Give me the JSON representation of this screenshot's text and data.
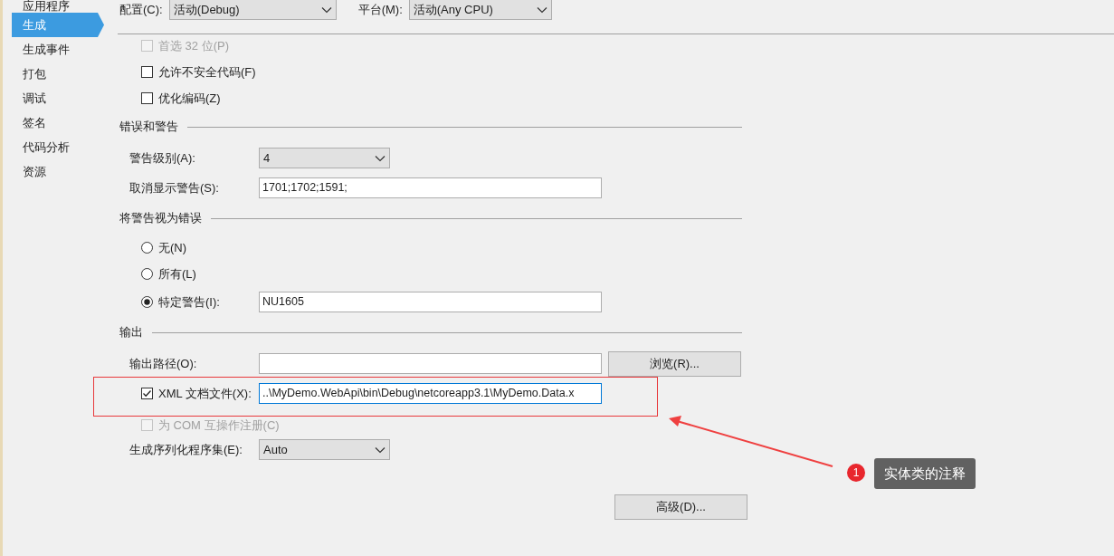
{
  "sidebar": {
    "items": [
      {
        "label": "应用程序",
        "selected": false
      },
      {
        "label": "生成",
        "selected": true
      },
      {
        "label": "生成事件",
        "selected": false
      },
      {
        "label": "打包",
        "selected": false
      },
      {
        "label": "调试",
        "selected": false
      },
      {
        "label": "签名",
        "selected": false
      },
      {
        "label": "代码分析",
        "selected": false
      },
      {
        "label": "资源",
        "selected": false
      }
    ]
  },
  "configuration": {
    "label": "配置(C):",
    "value": "活动(Debug)"
  },
  "platform": {
    "label": "平台(M):",
    "value": "活动(Any CPU)"
  },
  "general": [
    {
      "label": "首选 32 位(P)",
      "checked": false,
      "disabled": true
    },
    {
      "label": "允许不安全代码(F)",
      "checked": false,
      "disabled": false
    },
    {
      "label": "优化编码(Z)",
      "checked": false,
      "disabled": false
    }
  ],
  "sections": [
    {
      "title": "错误和警告",
      "rows": [
        {
          "kind": "combo",
          "label": "警告级别(A):",
          "value": "4"
        },
        {
          "kind": "text",
          "label": "取消显示警告(S):",
          "value": "1701;1702;1591;"
        }
      ]
    },
    {
      "title": "将警告视为错误",
      "rows": [
        {
          "kind": "radio",
          "label": "无(N)",
          "selected": false
        },
        {
          "kind": "radio",
          "label": "所有(L)",
          "selected": false
        },
        {
          "kind": "radio",
          "label": "特定警告(I):",
          "selected": true,
          "value": "NU1605"
        }
      ]
    },
    {
      "title": "输出",
      "rows": [
        {
          "kind": "text",
          "label": "输出路径(O):",
          "button": "浏览(R)..."
        },
        {
          "kind": "check",
          "label": "XML 文档文件(X):",
          "checked": true,
          "disabled": false,
          "focused": true,
          "value": "..\\MyDemo.WebApi\\bin\\Debug\\netcoreapp3.1\\MyDemo.Data.x"
        },
        {
          "kind": "check",
          "label": "为 COM 互操作注册(C)",
          "checked": false,
          "disabled": true
        },
        {
          "kind": "combo",
          "label": "生成序列化程序集(E):",
          "value": "Auto"
        },
        {
          "kind": "button",
          "label": "高级(D)..."
        }
      ]
    }
  ],
  "annotation": {
    "number": "1",
    "text": "实体类的注释"
  }
}
